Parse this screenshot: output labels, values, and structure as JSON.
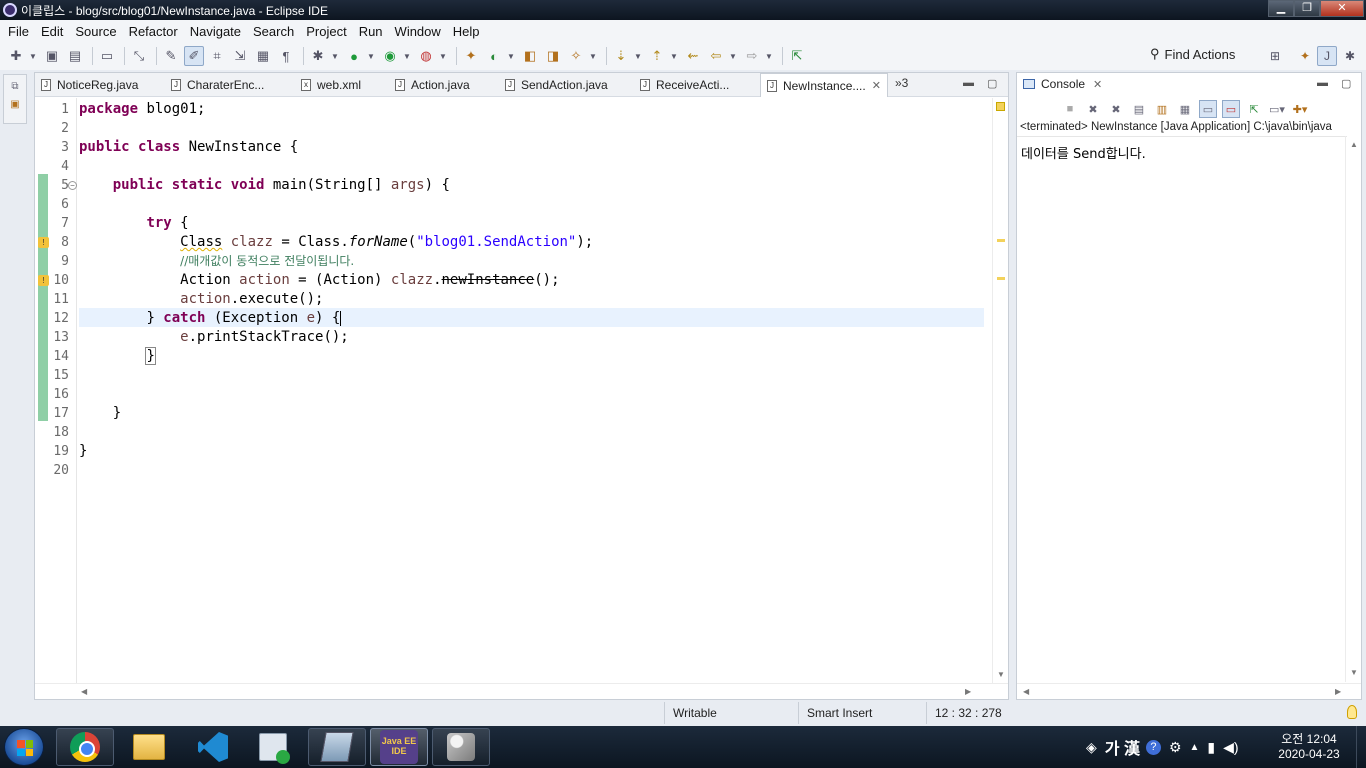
{
  "window": {
    "title": "이클립스 - blog/src/blog01/NewInstance.java - Eclipse IDE",
    "minimize_label": "▁",
    "restore_label": "❐",
    "close_label": "✕"
  },
  "menu": [
    "File",
    "Edit",
    "Source",
    "Refactor",
    "Navigate",
    "Search",
    "Project",
    "Run",
    "Window",
    "Help"
  ],
  "toolbar": {
    "find_actions_label": "Find Actions"
  },
  "editor": {
    "tabs": [
      {
        "label": "NoticeReg.java",
        "active": false
      },
      {
        "label": "CharaterEnc...",
        "active": false
      },
      {
        "label": "web.xml",
        "active": false
      },
      {
        "label": "Action.java",
        "active": false
      },
      {
        "label": "SendAction.java",
        "active": false
      },
      {
        "label": "ReceiveActi...",
        "active": false
      },
      {
        "label": "NewInstance....",
        "active": true
      }
    ],
    "overflow_label": "»3",
    "line_numbers": [
      "1",
      "2",
      "3",
      "4",
      "5",
      "6",
      "7",
      "8",
      "9",
      "10",
      "11",
      "12",
      "13",
      "14",
      "15",
      "16",
      "17",
      "18",
      "19",
      "20"
    ],
    "code": {
      "l1_kw": "package",
      "l1_rest": " blog01;",
      "l3_kw": "public class",
      "l3_rest": " NewInstance {",
      "l5_indent": "    ",
      "l5_kw": "public static void",
      "l5_rest": " main(String[] ",
      "l5_var": "args",
      "l5_end": ") {",
      "l7_indent": "        ",
      "l7_kw": "try",
      "l7_rest": " {",
      "l8_indent": "            ",
      "l8_type": "Class",
      "l8_sp": " ",
      "l8_var": "clazz",
      "l8_mid": " = Class.",
      "l8_method": "forName",
      "l8_open": "(",
      "l8_str": "\"blog01.SendAction\"",
      "l8_end": ");",
      "l9_indent": "            ",
      "l9_comment": "//매개값이 동적으로 전달이됩니다.",
      "l10_indent": "            ",
      "l10_a": "Action ",
      "l10_var": "action",
      "l10_b": " = (Action) ",
      "l10_var2": "clazz",
      "l10_dot": ".",
      "l10_dep": "newInstance",
      "l10_end": "();",
      "l11_indent": "            ",
      "l11_var": "action",
      "l11_rest": ".execute();",
      "l12_indent": "        ",
      "l12_a": "} ",
      "l12_kw": "catch",
      "l12_b": " (Exception ",
      "l12_var": "e",
      "l12_end": ") {",
      "l13_indent": "            ",
      "l13_var": "e",
      "l13_rest": ".printStackTrace();",
      "l14_indent": "        ",
      "l14_brace": "}",
      "l17_indent": "    ",
      "l17_brace": "}",
      "l19_brace": "}"
    }
  },
  "console": {
    "tab_label": "Console",
    "status_line": "<terminated> NewInstance [Java Application] C:\\java\\bin\\java",
    "output": "데이터를 Send합니다."
  },
  "statusbar": {
    "writable": "Writable",
    "insert_mode": "Smart Insert",
    "position": "12 : 32 : 278"
  },
  "taskbar": {
    "eclipse_label": "Java EE IDE",
    "ime_label": "가 漢",
    "clock_time": "오전 12:04",
    "clock_date": "2020-04-23"
  }
}
